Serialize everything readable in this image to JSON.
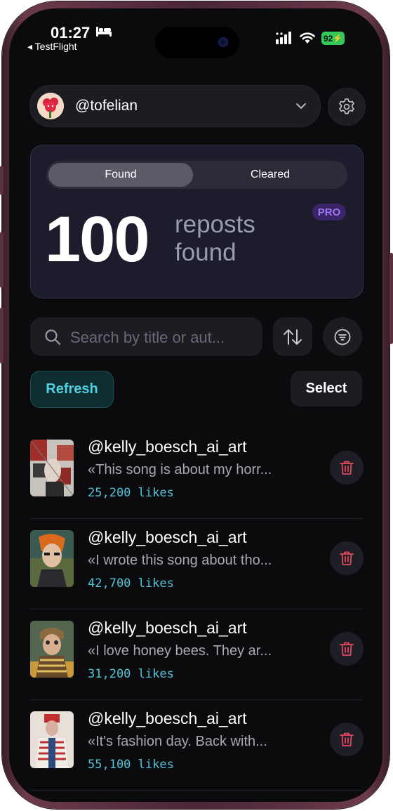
{
  "status_bar": {
    "time": "01:27",
    "back_app": "◂ TestFlight",
    "battery": "92"
  },
  "account": {
    "username": "@tofelian"
  },
  "stats": {
    "tabs": [
      {
        "label": "Found",
        "active": true
      },
      {
        "label": "Cleared",
        "active": false
      }
    ],
    "count": "100",
    "count_label": "reposts found",
    "badge": "PRO"
  },
  "search": {
    "placeholder": "Search by title or aut..."
  },
  "actions": {
    "refresh_label": "Refresh",
    "select_label": "Select"
  },
  "reposts": [
    {
      "author": "@kelly_boesch_ai_art",
      "excerpt": "«This song is about my horr...",
      "likes": "25,200 likes"
    },
    {
      "author": "@kelly_boesch_ai_art",
      "excerpt": "«I wrote this song about tho...",
      "likes": "42,700 likes"
    },
    {
      "author": "@kelly_boesch_ai_art",
      "excerpt": "«I love honey bees. They ar...",
      "likes": "31,200 likes"
    },
    {
      "author": "@kelly_boesch_ai_art",
      "excerpt": "«It's fashion day. Back with...",
      "likes": "55,100 likes"
    }
  ],
  "colors": {
    "accent_cyan": "#4fd1e0",
    "danger": "#e5485d",
    "pro_purple": "#a076f2",
    "battery_green": "#34c759"
  }
}
